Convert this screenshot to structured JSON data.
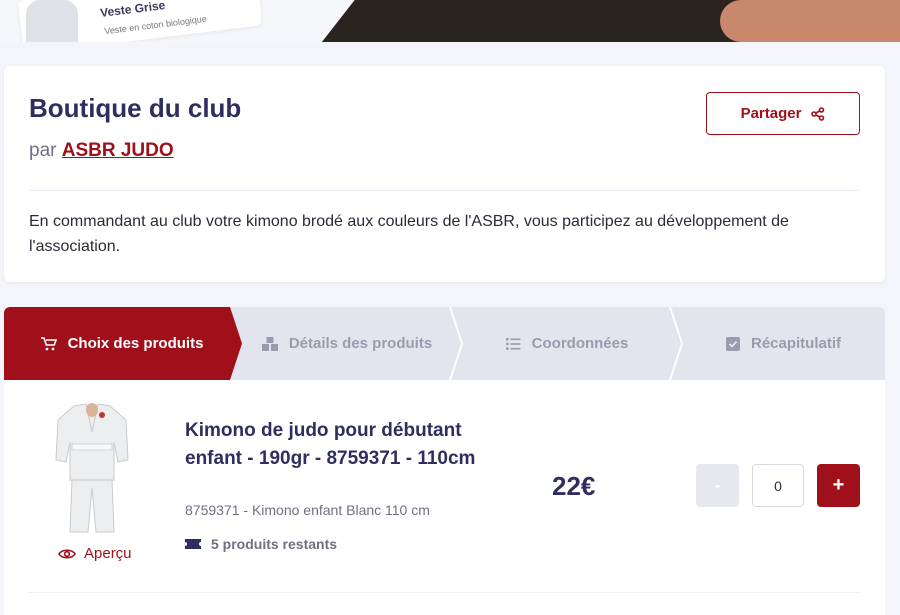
{
  "banner": {
    "product_title": "Veste Grise",
    "product_subtitle": "Veste en coton biologique"
  },
  "header": {
    "title": "Boutique du club",
    "by_prefix": "par",
    "organizer": "ASBR JUDO",
    "share_label": "Partager",
    "description": "En commandant au club votre kimono brodé aux couleurs de l'ASBR, vous participez au développement de l'association."
  },
  "steps": [
    {
      "label": "Choix des produits",
      "icon": "cart-icon",
      "active": true
    },
    {
      "label": "Détails des produits",
      "icon": "boxes-icon",
      "active": false
    },
    {
      "label": "Coordonnées",
      "icon": "list-icon",
      "active": false
    },
    {
      "label": "Récapitulatif",
      "icon": "checkbox-icon",
      "active": false
    }
  ],
  "product": {
    "name": "Kimono de judo pour débutant enfant - 190gr - 8759371 - 110cm",
    "reference": "8759371 - Kimono enfant Blanc 110 cm",
    "preview_label": "Aperçu",
    "stock_label": "5 produits restants",
    "price": "22€",
    "minus_label": "-",
    "quantity": "0",
    "plus_label": "+"
  },
  "colors": {
    "accent": "#a0101a",
    "title": "#2e2f5e",
    "step_inactive_bg": "#e3e5ee"
  }
}
